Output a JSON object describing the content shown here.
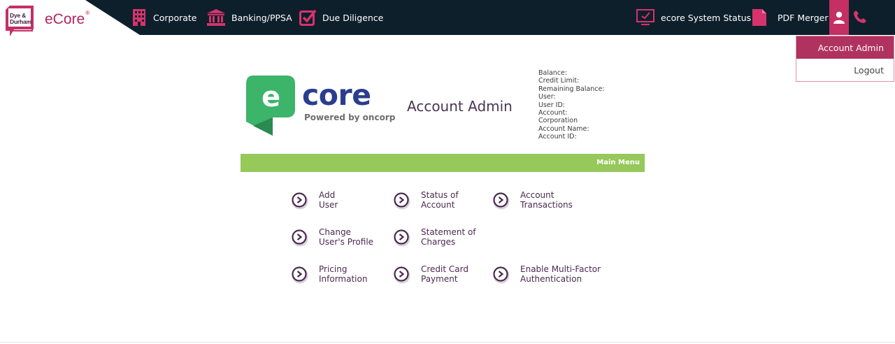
{
  "header": {
    "dd_logo_text_line1": "Dye &",
    "dd_logo_text_line2": "Durham",
    "brand": "eCore",
    "brand_mark": "®",
    "nav": [
      {
        "label": "Corporate",
        "icon": "building-icon"
      },
      {
        "label": "Banking/PPSA",
        "icon": "bank-icon"
      },
      {
        "label": "Due Diligence",
        "icon": "checkbox-icon"
      },
      {
        "label": "ecore System Status",
        "icon": "monitor-check-icon"
      },
      {
        "label": "PDF Merger",
        "icon": "document-icon"
      }
    ],
    "user_icon": "user-icon",
    "phone_icon": "phone-icon"
  },
  "dropdown": {
    "items": [
      "Account Admin",
      "Logout"
    ]
  },
  "main": {
    "logo_text": "core",
    "logo_letter": "e",
    "powered_by": "Powered by oncorp",
    "title": "Account Admin",
    "info": [
      "Balance:",
      "Credit Limit:",
      "Remaining Balance:",
      "User:",
      "User ID:",
      "Account:",
      "Corporation",
      "Account Name:",
      "Account ID:"
    ],
    "menu_label": "Main Menu",
    "options": [
      {
        "line1": "Add",
        "line2": "User"
      },
      {
        "line1": "Status of",
        "line2": "Account"
      },
      {
        "line1": "Account",
        "line2": "Transactions"
      },
      {
        "line1": "Change",
        "line2": "User's Profile"
      },
      {
        "line1": "Statement of",
        "line2": "Charges"
      },
      {
        "line1": "Pricing",
        "line2": "Information"
      },
      {
        "line1": "Credit Card",
        "line2": "Payment"
      },
      {
        "line1": "Enable Multi-Factor",
        "line2": "Authentication"
      }
    ]
  },
  "colors": {
    "topbar": "#0d1f2b",
    "accent": "#c42f64",
    "menu_bar": "#96c85a",
    "ecore_green": "#3cb469",
    "ecore_blue": "#2b3d8f"
  }
}
